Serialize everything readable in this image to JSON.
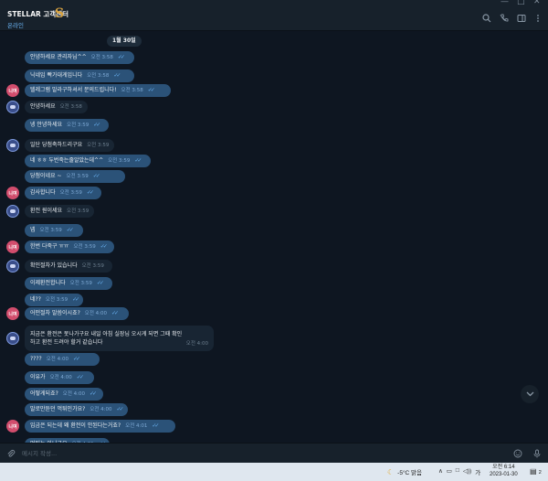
{
  "window": {
    "minimize": "—",
    "maximize": "□",
    "close": "✕"
  },
  "header": {
    "title": "STELLAR 고객센터",
    "badge": "S",
    "status": "온라인",
    "icons": [
      "search-icon",
      "phone-icon",
      "sidebar-icon",
      "more-vertical-icon"
    ]
  },
  "chat": {
    "date": "1월 30일",
    "messages": [
      {
        "side": "out",
        "text": "안녕하세요 관리자님^^",
        "time": "오전 3:58",
        "read": true
      },
      {
        "side": "out",
        "text": "닉네임 빡가대게입니다",
        "time": "오전 3:58",
        "read": true
      },
      {
        "side": "out",
        "avatar": "pink",
        "text": "텔레그램 말라구하셔서 문의드립니다!",
        "time": "오전 3:58",
        "read": true
      },
      {
        "side": "in",
        "avatar": "blue",
        "text": "안녕하세요",
        "time": "오전 3:58"
      },
      {
        "side": "out",
        "text": "넹 안녕하세요",
        "time": "오전 3:59",
        "read": true
      },
      {
        "side": "in",
        "avatar": "blue",
        "text": "일단 당첨축하드리구요",
        "time": "오전 3:59"
      },
      {
        "side": "out",
        "text": "네 ㅎㅎ 두번죽는줄알았는데^^",
        "time": "오전 3:59",
        "read": true
      },
      {
        "side": "out",
        "text": "당첨이네요 ~",
        "time": "오전 3:59",
        "read": true
      },
      {
        "side": "out",
        "avatar": "pink",
        "text": "감사합니다",
        "time": "오전 3:59",
        "read": true
      },
      {
        "side": "in",
        "avatar": "blue",
        "text": "환전 원이세요",
        "time": "오전 3:59"
      },
      {
        "side": "out",
        "text": "넵",
        "time": "오전 3:59",
        "read": true
      },
      {
        "side": "out",
        "avatar": "pink",
        "text": "한번 다죽구 ㅠㅠ",
        "time": "오전 3:59",
        "read": true
      },
      {
        "side": "in",
        "avatar": "blue",
        "text": "확인절차가 있습니다",
        "time": "오전 3:59"
      },
      {
        "side": "out",
        "text": "이제환전합니다",
        "time": "오전 3:59",
        "read": true
      },
      {
        "side": "out",
        "text": "네??",
        "time": "오전 3:59",
        "read": true
      },
      {
        "side": "out",
        "avatar": "pink",
        "text": "어떤절차 말씀이시죠?",
        "time": "오전 4:00",
        "read": true
      },
      {
        "side": "in",
        "avatar": "blue",
        "tall": true,
        "text": "지금은 환전은 못나가구요 내일 아침 실장님 오시게 되면 그때 확인",
        "text2": "하고 환전 드려야 할거 같습니다",
        "time": "오전 4:00"
      },
      {
        "side": "out",
        "text": "????",
        "time": "오전 4:00",
        "read": true
      },
      {
        "side": "out",
        "text": "이유가",
        "time": "오전 4:00",
        "read": true
      },
      {
        "side": "out",
        "text": "어떻게되죠?",
        "time": "오전 4:00",
        "read": true
      },
      {
        "side": "out",
        "text": "말로만듣던 먹튀인가요?",
        "time": "오전 4:00",
        "read": true
      },
      {
        "side": "out",
        "avatar": "pink",
        "text": "입금은 되는데 왜 환전이 안된다는거죠?",
        "time": "오전 4:01",
        "read": true
      },
      {
        "side": "out",
        "text": "먹튀는 아니구요",
        "time": "오전 4:01",
        "read": true
      }
    ],
    "avatar_label": "니여"
  },
  "composer": {
    "placeholder": "메시지 작성..."
  },
  "taskbar": {
    "weather": "-5°C 맑음",
    "tray": [
      "∧",
      "▭",
      "□",
      "◁))",
      "가"
    ],
    "time": "오전 6:14",
    "date": "2023-01-30",
    "notifications": "2"
  },
  "colors": {
    "chat_bg": "#0e1621",
    "outgoing": "#2b5278",
    "incoming": "#182533",
    "accent": "#6ab2f2"
  }
}
